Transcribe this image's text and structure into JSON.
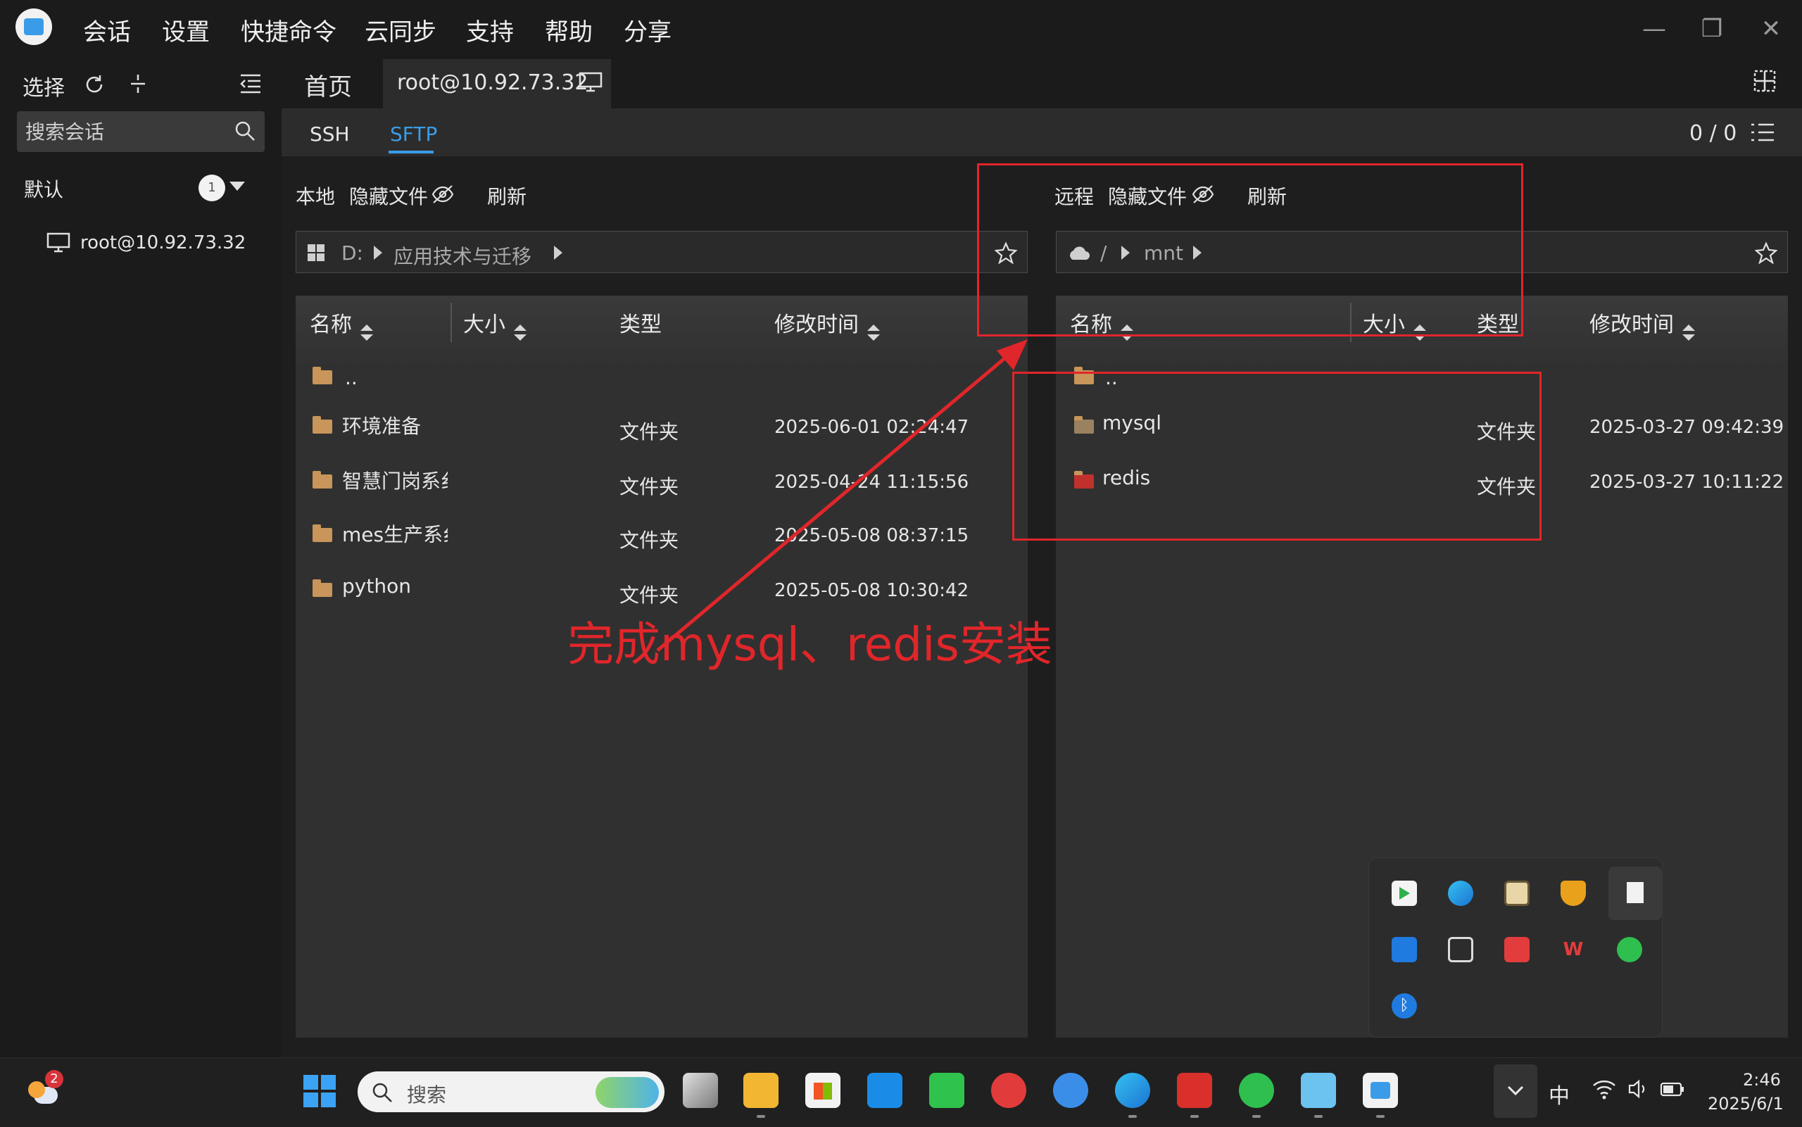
{
  "menu": [
    "会话",
    "设置",
    "快捷命令",
    "云同步",
    "支持",
    "帮助",
    "分享"
  ],
  "window_controls": {
    "minimize": "—",
    "maximize": "❐",
    "close": "✕"
  },
  "sidebar": {
    "select_label": "选择",
    "search_placeholder": "搜索会话",
    "group_name": "默认",
    "group_count": "1",
    "session_item": "root@10.92.73.32"
  },
  "tabs": {
    "home": "首页",
    "session": "root@10.92.73.32"
  },
  "subtabs": {
    "ssh": "SSH",
    "sftp": "SFTP",
    "active": "SFTP",
    "counter": "0 / 0"
  },
  "local": {
    "label": "本地",
    "hidden_files": "隐藏文件",
    "refresh": "刷新",
    "path": [
      "D:",
      "应用技术与迁移"
    ],
    "headers": {
      "name": "名称",
      "size": "大小",
      "type": "类型",
      "mtime": "修改时间"
    },
    "rows": [
      {
        "name": "..",
        "type": "",
        "mtime": ""
      },
      {
        "name": "环境准备",
        "type": "文件夹",
        "mtime": "2025-06-01 02:24:47"
      },
      {
        "name": "智慧门岗系纟",
        "type": "文件夹",
        "mtime": "2025-04-24 11:15:56"
      },
      {
        "name": "mes生产系纟",
        "type": "文件夹",
        "mtime": "2025-05-08 08:37:15"
      },
      {
        "name": "python",
        "type": "文件夹",
        "mtime": "2025-05-08 10:30:42"
      }
    ]
  },
  "remote": {
    "label": "远程",
    "hidden_files": "隐藏文件",
    "refresh": "刷新",
    "path": [
      "/",
      "mnt"
    ],
    "headers": {
      "name": "名称",
      "size": "大小",
      "type": "类型",
      "mtime": "修改时间"
    },
    "rows": [
      {
        "name": "..",
        "type": "",
        "mtime": ""
      },
      {
        "name": "mysql",
        "type": "文件夹",
        "mtime": "2025-03-27 09:42:39"
      },
      {
        "name": "redis",
        "type": "文件夹",
        "mtime": "2025-03-27 10:11:22"
      }
    ]
  },
  "annotation": "完成mysql、redis安装",
  "annotation_color": "#e0262a",
  "taskbar": {
    "weather_badge": "2",
    "search_placeholder": "搜索",
    "ime": "中",
    "time": "2:46",
    "date": "2025/6/1"
  },
  "colors": {
    "accent": "#3a9ce8",
    "folder": "#c8955a"
  }
}
